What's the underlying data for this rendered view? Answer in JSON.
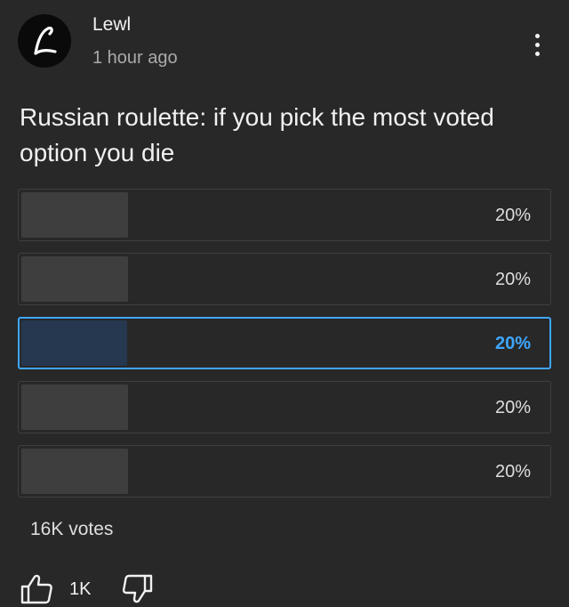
{
  "post": {
    "author": "Lewl",
    "avatar_letter": "L",
    "timestamp": "1 hour ago",
    "question": "Russian roulette: if you pick the most voted option you die"
  },
  "poll": {
    "options": [
      {
        "percent_label": "20%",
        "share": 0.2,
        "selected": false
      },
      {
        "percent_label": "20%",
        "share": 0.2,
        "selected": false
      },
      {
        "percent_label": "20%",
        "share": 0.2,
        "selected": true
      },
      {
        "percent_label": "20%",
        "share": 0.2,
        "selected": false
      },
      {
        "percent_label": "20%",
        "share": 0.2,
        "selected": false
      }
    ],
    "votes_label": "16K votes"
  },
  "actions": {
    "like_count": "1K",
    "like_icon": "thumbs-up-icon",
    "dislike_icon": "thumbs-down-icon",
    "menu_icon": "more-vertical-icon"
  },
  "colors": {
    "background": "#282828",
    "selected_accent": "#3ea6ff",
    "selected_fill": "#263850",
    "bar_fill": "#3e3e3e"
  }
}
